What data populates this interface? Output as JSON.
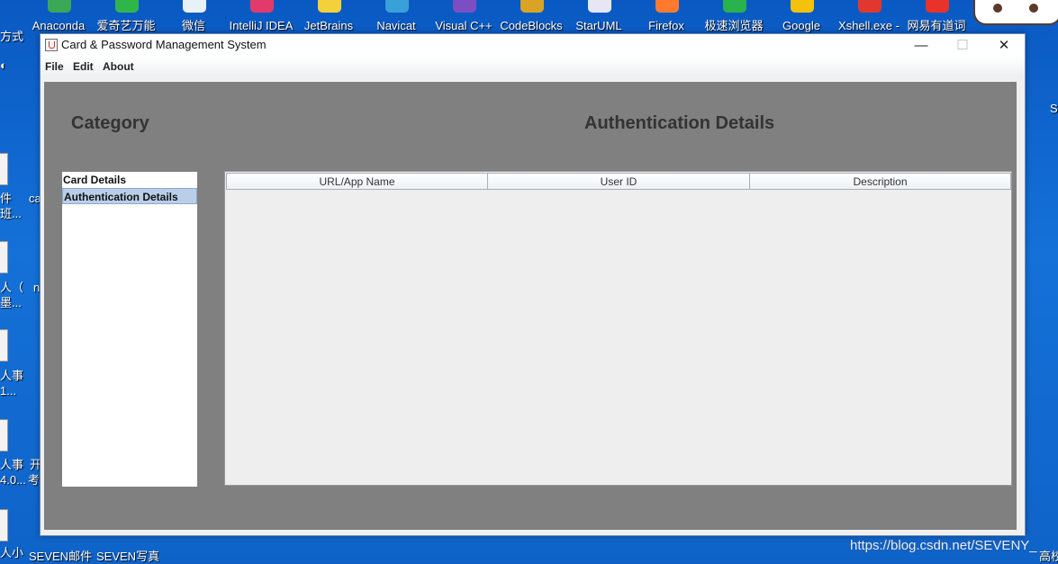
{
  "desktop": {
    "top_icons": [
      {
        "label": "Anaconda",
        "color": "#3aa856"
      },
      {
        "label": "爱奇艺万能",
        "color": "#2fb54a"
      },
      {
        "label": "微信",
        "color": "#e8f0f8"
      },
      {
        "label": "IntelliJ IDEA",
        "color": "#e23b6b"
      },
      {
        "label": "JetBrains",
        "color": "#f2d13b"
      },
      {
        "label": "Navicat",
        "color": "#39a0d8"
      },
      {
        "label": "Visual C++",
        "color": "#7b4fc3"
      },
      {
        "label": "CodeBlocks",
        "color": "#d9a325"
      },
      {
        "label": "StarUML",
        "color": "#e6e6f5"
      },
      {
        "label": "Firefox",
        "color": "#ff7a2e"
      },
      {
        "label": "极速浏览器",
        "color": "#29b24d"
      },
      {
        "label": "Google",
        "color": "#f4c20d"
      },
      {
        "label": "Xshell.exe -",
        "color": "#e0382f"
      },
      {
        "label": "网易有道词",
        "color": "#e8322a"
      }
    ],
    "left_fragments": [
      "方式",
      "件",
      "班...",
      "人（",
      "墨...",
      "人事",
      "1...",
      "人事",
      "4.0...",
      "人小"
    ],
    "mid_fragments": [
      "ca",
      "n",
      "开",
      "考"
    ],
    "bottom_labels": [
      "SEVEN邮件",
      "SEVEN写真"
    ],
    "watermark": "https://blog.csdn.net/SEVENY_",
    "corner_text": "高校"
  },
  "window": {
    "title": "Card & Password Management System",
    "minimize_glyph": "—",
    "maximize_glyph": "☐",
    "close_glyph": "✕"
  },
  "menu": [
    "File",
    "Edit",
    "About"
  ],
  "category": {
    "heading": "Category",
    "items": [
      "Card Details",
      "Authentication Details"
    ],
    "selected_index": 1
  },
  "details": {
    "heading": "Authentication Details",
    "columns": [
      "URL/App Name",
      "User ID",
      "Description"
    ],
    "rows": []
  }
}
